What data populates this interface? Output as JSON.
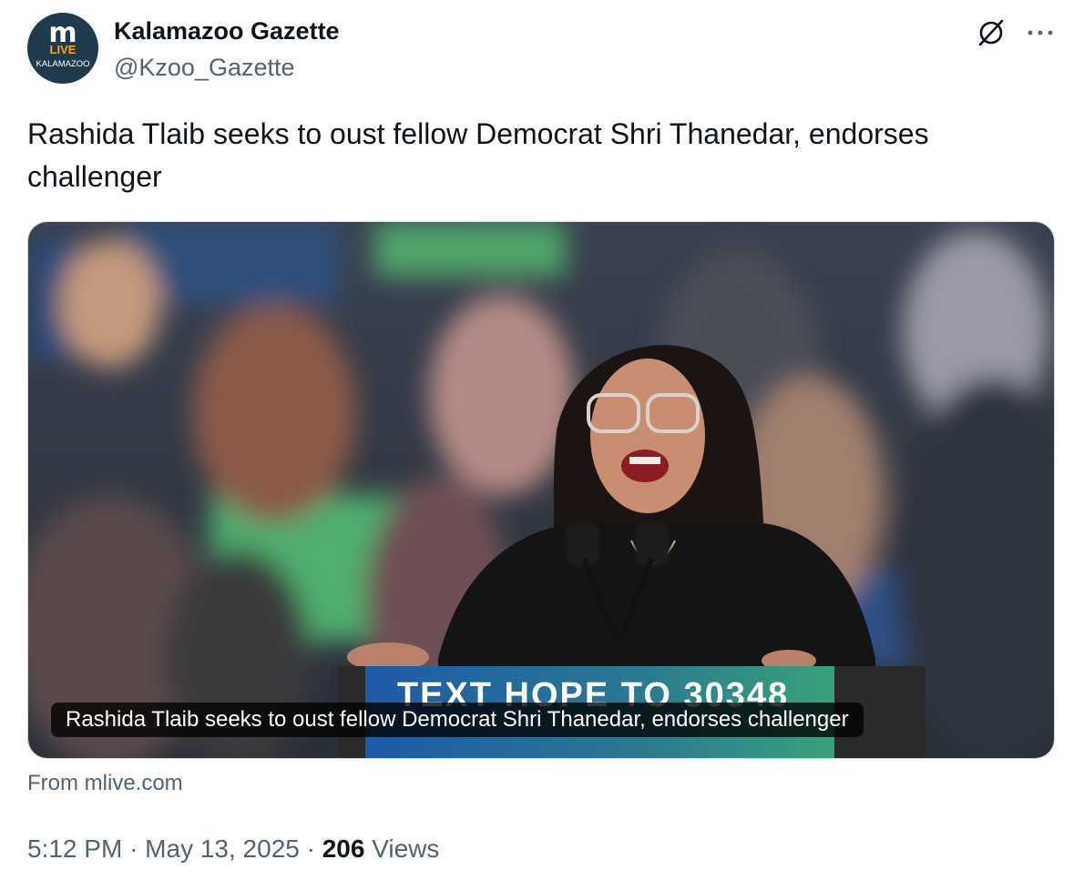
{
  "account": {
    "name": "Kalamazoo Gazette",
    "handle": "@Kzoo_Gazette",
    "avatar": {
      "logo_letter": "m",
      "logo_word": "LIVE",
      "logo_city": "KALAMAZOO"
    }
  },
  "tweet": {
    "text": "Rashida Tlaib seeks to oust fellow Democrat Shri Thanedar, endorses challenger"
  },
  "card": {
    "caption": "Rashida Tlaib seeks to oust fellow Democrat Shri Thanedar, endorses challenger",
    "podium_text": "TEXT HOPE TO 30348",
    "source": "From mlive.com"
  },
  "meta": {
    "time": "5:12 PM",
    "date": "May 13, 2025",
    "separator": "·",
    "views_count": "206",
    "views_label": "Views"
  },
  "icons": [
    "grok-icon",
    "more-icon"
  ],
  "colors": {
    "text": "#0f1419",
    "secondary": "#536471",
    "avatar_bg": "#1e3a4c",
    "live_orange": "#f5a623"
  }
}
